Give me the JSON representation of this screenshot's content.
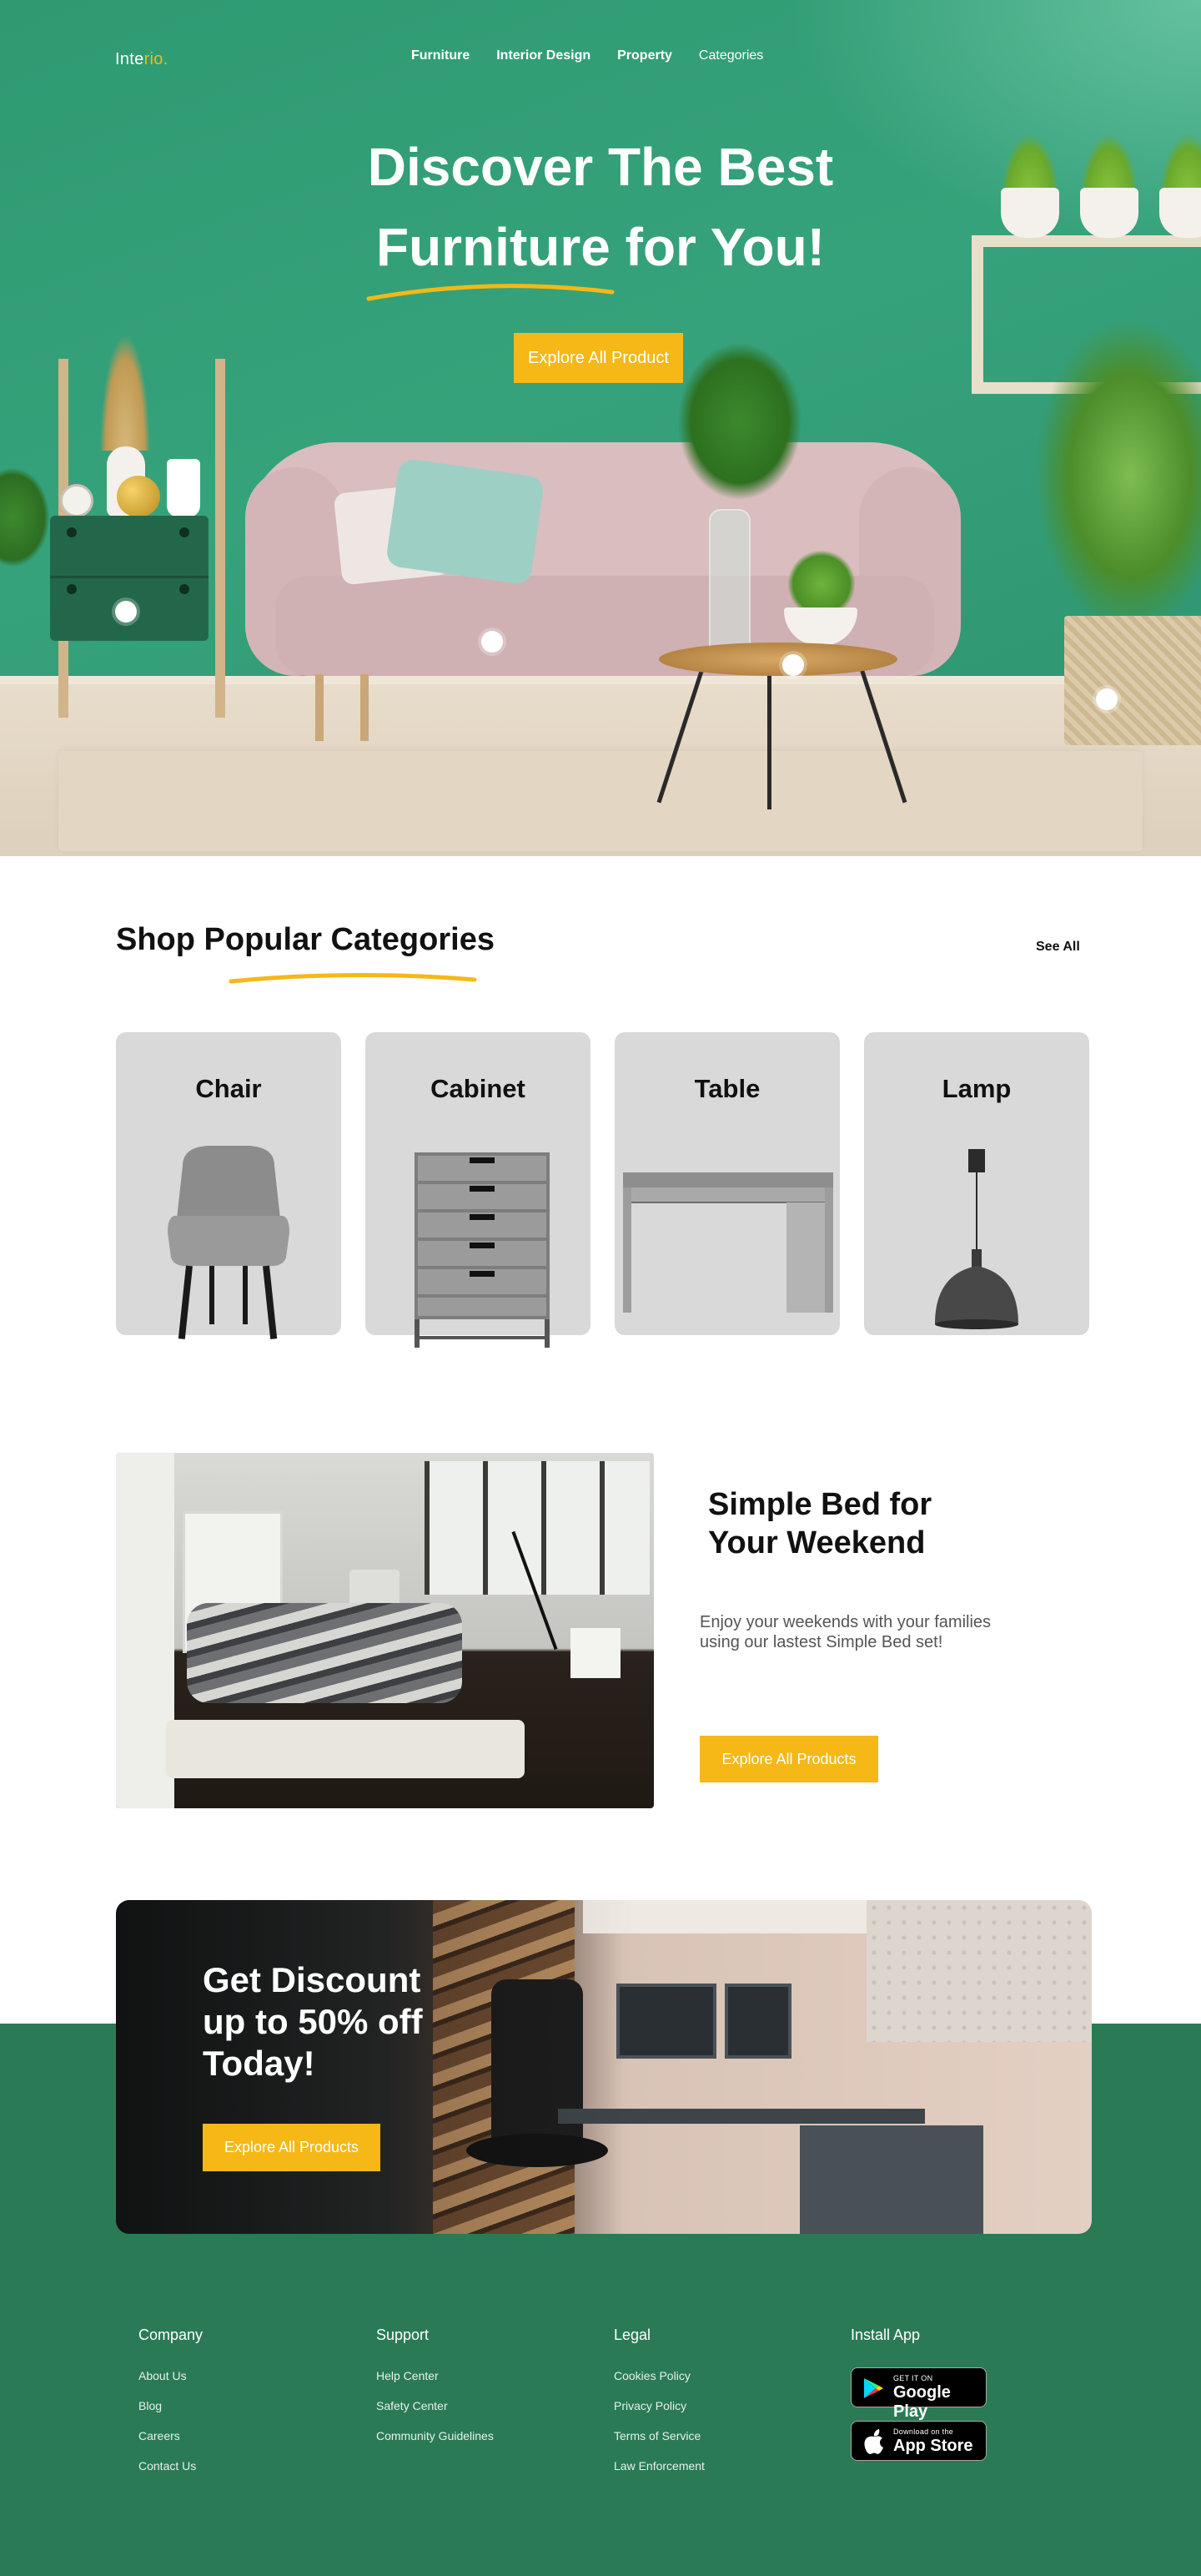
{
  "brand": {
    "name_main": "Inte",
    "name_accent": "rio."
  },
  "nav": {
    "items": [
      {
        "label": "Furniture"
      },
      {
        "label": "Interior Design"
      },
      {
        "label": "Property"
      },
      {
        "label": "Categories"
      }
    ]
  },
  "hero": {
    "title_line1": "Discover The Best",
    "title_line2": "Furniture for You!",
    "button_label": "Explore All Product"
  },
  "categories": {
    "title": "Shop Popular Categories",
    "see_all": "See All",
    "items": [
      {
        "label": "Chair"
      },
      {
        "label": "Cabinet"
      },
      {
        "label": "Table"
      },
      {
        "label": "Lamp"
      }
    ]
  },
  "feature": {
    "title": "Simple Bed for Your Weekend",
    "description": "Enjoy your weekends with your families using our lastest Simple Bed set!",
    "button_label": "Explore All Products"
  },
  "promo": {
    "title": "Get Discount up to 50% off Today!",
    "button_label": "Explore All Products"
  },
  "footer": {
    "columns": [
      {
        "heading": "Company",
        "links": [
          "About Us",
          "Blog",
          "Careers",
          "Contact Us"
        ]
      },
      {
        "heading": "Support",
        "links": [
          "Help Center",
          "Safety Center",
          "Community Guidelines"
        ]
      },
      {
        "heading": "Legal",
        "links": [
          "Cookies Policy",
          "Privacy Policy",
          "Terms of Service",
          "Law Enforcement"
        ]
      }
    ],
    "install": {
      "heading": "Install App",
      "google_small": "GET IT ON",
      "google_big": "Google Play",
      "apple_small": "Download on the",
      "apple_big": "App Store"
    }
  },
  "colors": {
    "accent": "#f5b817",
    "hero_green": "#36a27b",
    "footer_green": "#2a7a56",
    "card_gray": "#d9d9d9"
  }
}
